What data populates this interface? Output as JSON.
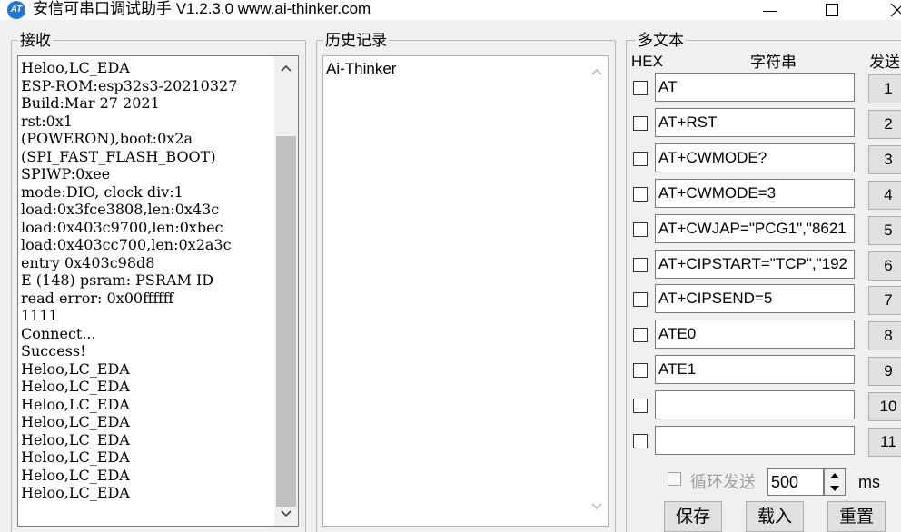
{
  "window": {
    "app_icon_text": "AT",
    "title": "安信可串口调试助手 V1.2.3.0    www.ai-thinker.com"
  },
  "receive": {
    "label": "接收",
    "lines": [
      "Heloo,LC_EDA",
      "ESP-ROM:esp32s3-20210327",
      "Build:Mar 27 2021",
      "rst:0x1",
      "(POWERON),boot:0x2a",
      "(SPI_FAST_FLASH_BOOT)",
      "SPIWP:0xee",
      "mode:DIO, clock div:1",
      "load:0x3fce3808,len:0x43c",
      "load:0x403c9700,len:0xbec",
      "load:0x403cc700,len:0x2a3c",
      "entry 0x403c98d8",
      "E (148) psram: PSRAM ID",
      "read error: 0x00ffffff",
      "1111",
      "Connect...",
      "Success!",
      "Heloo,LC_EDA",
      "Heloo,LC_EDA",
      "Heloo,LC_EDA",
      "Heloo,LC_EDA",
      "Heloo,LC_EDA",
      "Heloo,LC_EDA",
      "Heloo,LC_EDA",
      "Heloo,LC_EDA"
    ]
  },
  "history": {
    "label": "历史记录",
    "items": [
      "Ai-Thinker"
    ]
  },
  "multi": {
    "label": "多文本",
    "hex_header": "HEX",
    "string_header": "字符串",
    "send_header": "发送",
    "rows": [
      {
        "text": "AT",
        "button": "1"
      },
      {
        "text": "AT+RST",
        "button": "2"
      },
      {
        "text": "AT+CWMODE?",
        "button": "3"
      },
      {
        "text": "AT+CWMODE=3",
        "button": "4"
      },
      {
        "text": "AT+CWJAP=\"PCG1\",\"8621",
        "button": "5"
      },
      {
        "text": "AT+CIPSTART=\"TCP\",\"192",
        "button": "6"
      },
      {
        "text": "AT+CIPSEND=5",
        "button": "7"
      },
      {
        "text": "ATE0",
        "button": "8"
      },
      {
        "text": "ATE1",
        "button": "9"
      },
      {
        "text": "",
        "button": "10"
      },
      {
        "text": "",
        "button": "11"
      }
    ],
    "loop_send_label": "循环发送",
    "interval_value": "500",
    "interval_unit": "ms",
    "save_label": "保存",
    "load_label": "载入",
    "reset_label": "重置"
  }
}
